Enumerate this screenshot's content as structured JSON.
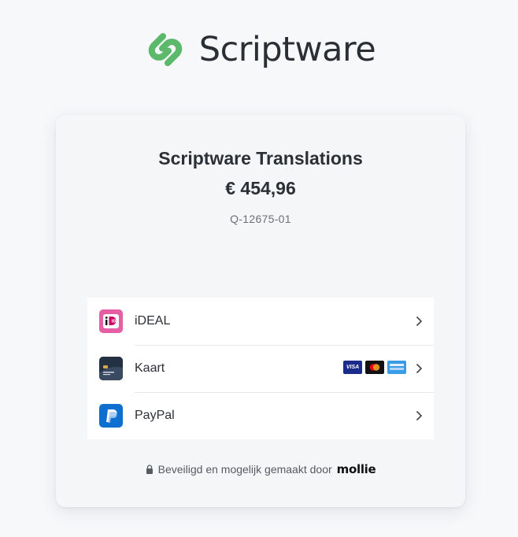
{
  "brand": {
    "name": "Scriptware",
    "logo_icon": "scriptware-chain-icon",
    "accent": "#5cb86a"
  },
  "order": {
    "title": "Scriptware Translations",
    "amount": "€ 454,96",
    "reference": "Q-12675-01"
  },
  "payment_methods": [
    {
      "label": "iDEAL",
      "icon": "ideal-icon",
      "brands": []
    },
    {
      "label": "Kaart",
      "icon": "credit-card-icon",
      "brands": [
        "visa-icon",
        "mastercard-icon",
        "amex-icon"
      ]
    },
    {
      "label": "PayPal",
      "icon": "paypal-icon",
      "brands": []
    }
  ],
  "card_brand_visa": "VISA",
  "footer": {
    "text": "Beveiligd en mogelijk gemaakt door",
    "provider": "mollie"
  }
}
